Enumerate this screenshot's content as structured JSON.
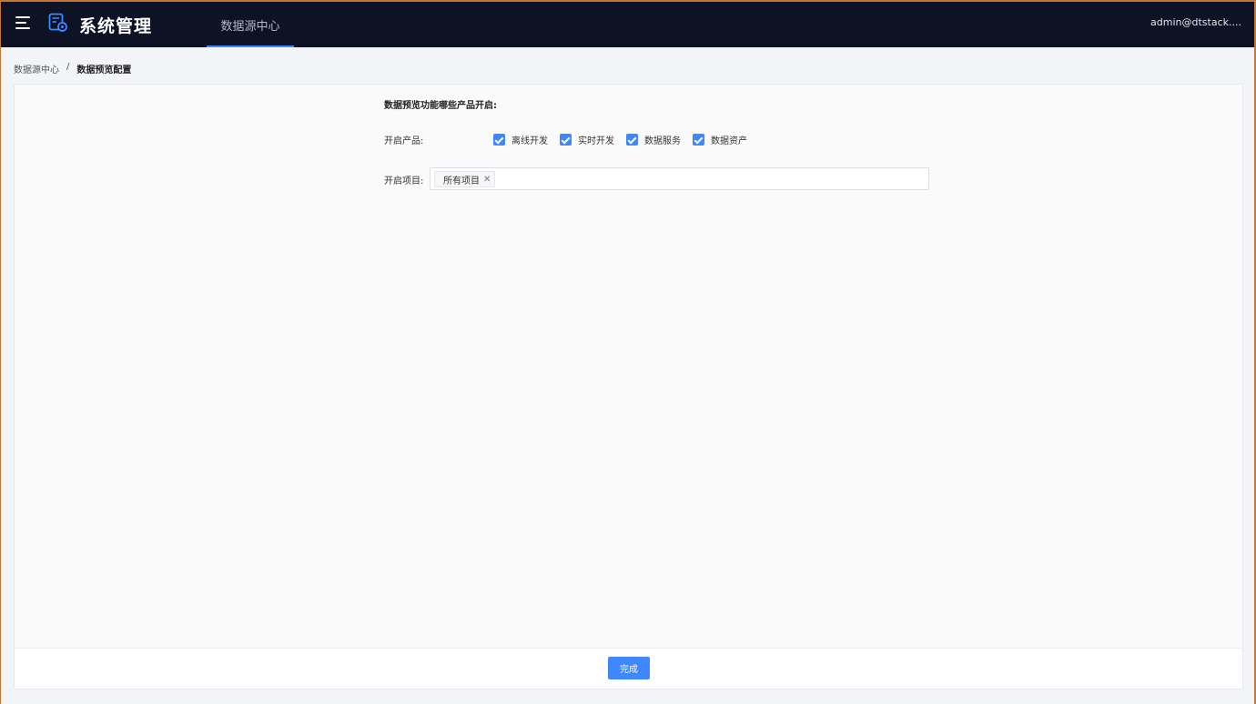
{
  "header": {
    "app_title": "系统管理",
    "nav_tab": "数据源中心",
    "user": "admin@dtstack...."
  },
  "breadcrumb": {
    "parent": "数据源中心",
    "separator": "/",
    "current": "数据预览配置"
  },
  "form": {
    "section_title": "数据预览功能哪些产品开启:",
    "products_label": "开启产品:",
    "products": [
      {
        "label": "离线开发",
        "checked": true
      },
      {
        "label": "实时开发",
        "checked": true
      },
      {
        "label": "数据服务",
        "checked": true
      },
      {
        "label": "数据资产",
        "checked": true
      }
    ],
    "projects_label": "开启项目:",
    "projects_tag": "所有项目"
  },
  "footer": {
    "done_label": "完成"
  },
  "colors": {
    "topbar": "#0d1224",
    "accent": "#3f87ff",
    "frame": "#c7763a"
  }
}
